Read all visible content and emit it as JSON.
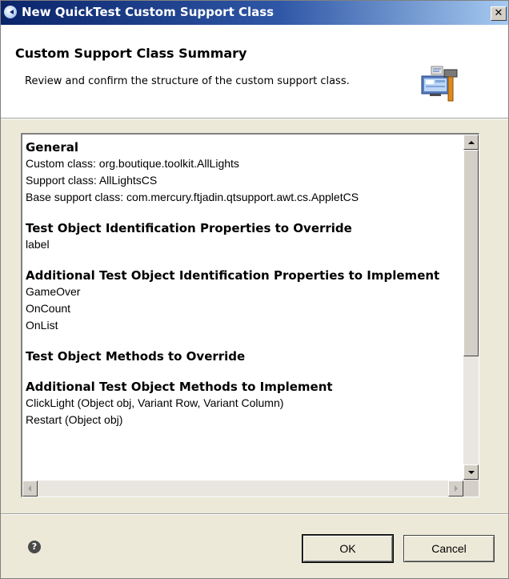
{
  "window": {
    "title": "New QuickTest Custom Support Class",
    "close_glyph": "✕"
  },
  "header": {
    "title": "Custom Support Class Summary",
    "description": "Review and confirm the structure of the custom support class.",
    "art_icon": "wizard-computer-hammer-icon"
  },
  "summary": {
    "general": {
      "heading": "General",
      "lines": [
        "Custom class: org.boutique.toolkit.AllLights",
        "Support class: AllLightsCS",
        "Base support class: com.mercury.ftjadin.qtsupport.awt.cs.AppletCS"
      ]
    },
    "props_override": {
      "heading": "Test Object Identification Properties to Override",
      "items": [
        "label"
      ]
    },
    "props_implement": {
      "heading": "Additional  Test Object Identification Properties to Implement",
      "items": [
        "GameOver",
        "OnCount",
        "OnList"
      ]
    },
    "methods_override": {
      "heading": "Test Object Methods to Override",
      "items": []
    },
    "methods_implement": {
      "heading": "Additional  Test Object Methods to Implement",
      "items": [
        "ClickLight (Object obj, Variant Row, Variant Column)",
        "Restart (Object obj)"
      ]
    },
    "scrollbar": {
      "vertical_position": 0.0
    }
  },
  "footer": {
    "help_glyph": "?",
    "ok_label": "OK",
    "cancel_label": "Cancel"
  },
  "colors": {
    "title_bar_start": "#0a246a",
    "title_bar_end": "#a6caf0",
    "dialog_bg": "#ece9d8"
  }
}
